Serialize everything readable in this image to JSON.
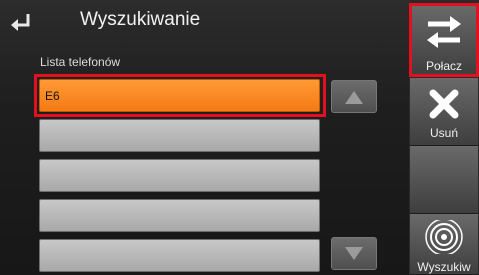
{
  "header": {
    "title": "Wyszukiwanie",
    "back_icon": "back-arrow-icon"
  },
  "list": {
    "label": "Lista telefonów",
    "items": [
      {
        "text": "E6",
        "selected": true
      },
      {
        "text": "",
        "selected": false
      },
      {
        "text": "",
        "selected": false
      },
      {
        "text": "",
        "selected": false
      },
      {
        "text": "",
        "selected": false
      }
    ],
    "scroll_up_icon": "triangle-up-icon",
    "scroll_down_icon": "triangle-down-icon"
  },
  "sidebar": {
    "connect": {
      "label": "Połacz",
      "icon": "swap-arrows-icon"
    },
    "delete": {
      "label": "Usuń",
      "icon": "x-icon"
    },
    "search": {
      "label": "Wyszukiw",
      "icon": "signal-rings-icon"
    }
  },
  "colors": {
    "selected_row": "#f57b14",
    "highlight": "#e3101f"
  }
}
